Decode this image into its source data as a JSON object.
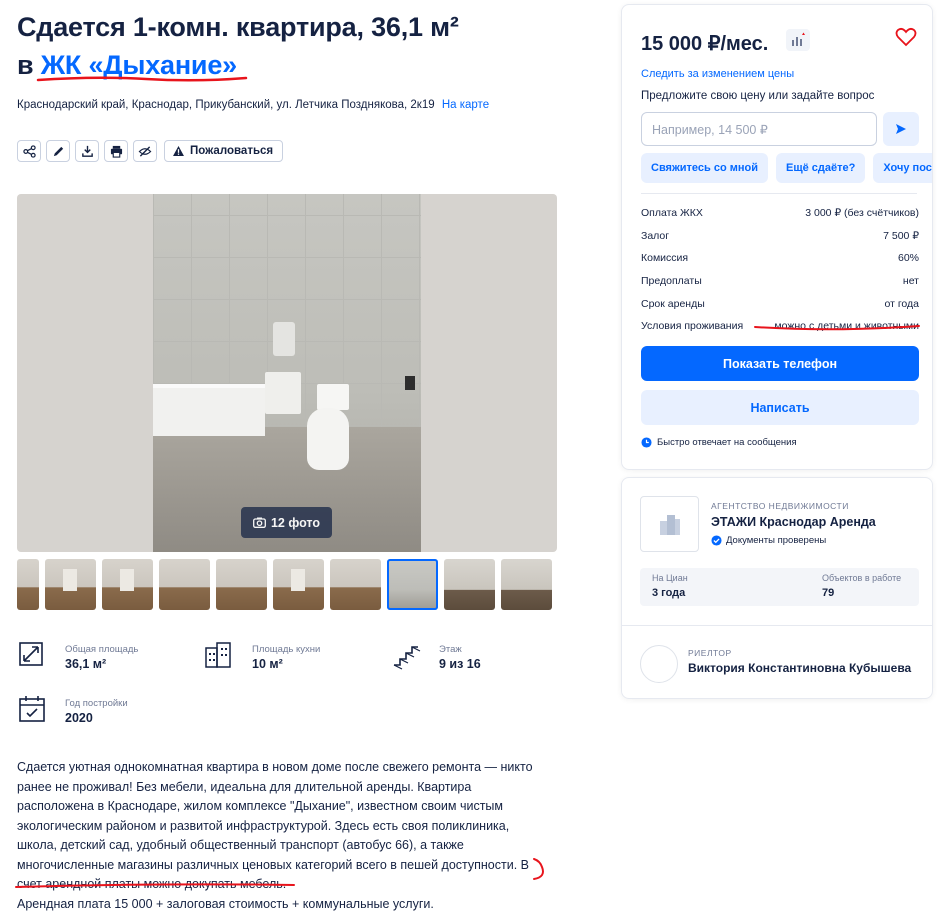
{
  "header": {
    "title_line1": "Сдается 1-комн. квартира, 36,1 м²",
    "title_prefix": "в ",
    "complex_link": "ЖК «Дыхание»",
    "address": "Краснодарский край, Краснодар, Прикубанский, ул. Летчика Позднякова, 2к19",
    "map_link": "На карте"
  },
  "toolbar": {
    "icons": [
      "share-icon",
      "edit-icon",
      "download-icon",
      "print-icon",
      "hide-icon"
    ],
    "complain_label": "Пожаловаться"
  },
  "gallery": {
    "photo_count": "12 фото",
    "thumbnail_count": 10,
    "selected_thumbnail": 7
  },
  "facts": [
    {
      "label": "Общая площадь",
      "value": "36,1 м²",
      "icon": "area-icon"
    },
    {
      "label": "Площадь кухни",
      "value": "10 м²",
      "icon": "kitchen-icon"
    },
    {
      "label": "Этаж",
      "value": "9 из 16",
      "icon": "stairs-icon"
    },
    {
      "label": "Год постройки",
      "value": "2020",
      "icon": "calendar-icon"
    }
  ],
  "description": {
    "p1": "Сдается уютная однокомнатная квартира в новом доме после свежего ремонта — никто ранее не проживал! Без мебели, идеальна для длительной аренды. Квартира расположена в Краснодаре, жилом комплексе \"Дыхание\", известном своим чистым экологическим районом и развитой инфраструктурой. Здесь есть своя поликлиника, школа, детский сад, удобный общественный транспорт (автобус  66), а также многочисленные магазины различных ценовых категорий всего в пешей доступности. В счет арендной платы можно докупать мебель.",
    "p2": "Арендная плата 15 000 + залоговая стоимость + коммунальные услуги."
  },
  "offer_card": {
    "price": "15 000 ₽/мес.",
    "track_link": "Следить за изменением цены",
    "offer_text": "Предложите свою цену или задайте вопрос",
    "price_placeholder": "Например, 14 500 ₽",
    "chips": [
      "Свяжитесь со мной",
      "Ещё сдаёте?",
      "Хочу посмотреть"
    ],
    "terms": [
      {
        "label": "Оплата ЖКХ",
        "value": "3 000 ₽ (без счётчиков)"
      },
      {
        "label": "Залог",
        "value": "7 500 ₽"
      },
      {
        "label": "Комиссия",
        "value": "60%"
      },
      {
        "label": "Предоплаты",
        "value": "нет"
      },
      {
        "label": "Срок аренды",
        "value": "от года"
      },
      {
        "label": "Условия проживания",
        "value": "можно с детьми и животными"
      }
    ],
    "show_phone": "Показать телефон",
    "write": "Написать",
    "fast_reply": "Быстро отвечает на сообщения"
  },
  "agency": {
    "kind": "АГЕНТСТВО НЕДВИЖИМОСТИ",
    "name": "ЭТАЖИ Краснодар Аренда",
    "verified": "Документы проверены",
    "stats": [
      {
        "label": "На Циан",
        "value": "3 года"
      },
      {
        "label": "Объектов в работе",
        "value": "79"
      }
    ],
    "realtor_kind": "РИЕЛТОР",
    "realtor_name": "Виктория Константиновна Кубышева"
  },
  "colors": {
    "accent": "#0468ff",
    "text": "#152242",
    "muted": "#707a95",
    "annotation_red": "#e8141c"
  }
}
